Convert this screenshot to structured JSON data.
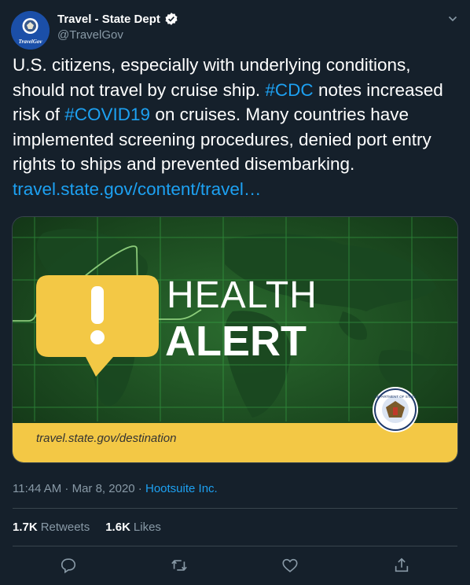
{
  "user": {
    "display_name": "Travel - State Dept",
    "handle": "@TravelGov",
    "avatar_text": "TravelGov"
  },
  "tweet": {
    "text_1": "U.S. citizens, especially with underlying conditions, should not travel by cruise ship.  ",
    "hashtag_1": "#CDC",
    "text_2": " notes increased risk of ",
    "hashtag_2": "#COVID19",
    "text_3": " on cruises. Many countries have implemented screening procedures, denied port entry rights to ships and prevented disembarking.",
    "link": "travel.state.gov/content/travel…"
  },
  "media": {
    "line_1": "HEALTH",
    "line_2": "ALERT",
    "url": "travel.state.gov/destination",
    "seal_text": "DEPARTMENT OF STATE"
  },
  "meta": {
    "time": "11:44 AM · Mar 8, 2020 · ",
    "source": "Hootsuite Inc."
  },
  "stats": {
    "retweets_count": "1.7K",
    "retweets_label": "Retweets",
    "likes_count": "1.6K",
    "likes_label": "Likes"
  },
  "icons": {
    "reply": "reply-icon",
    "retweet": "retweet-icon",
    "like": "like-icon",
    "share": "share-icon"
  },
  "colors": {
    "background": "#15202b",
    "link": "#1da1f2",
    "muted": "#8899a6",
    "alert_yellow": "#f3c845",
    "map_green": "#1d4a22"
  }
}
